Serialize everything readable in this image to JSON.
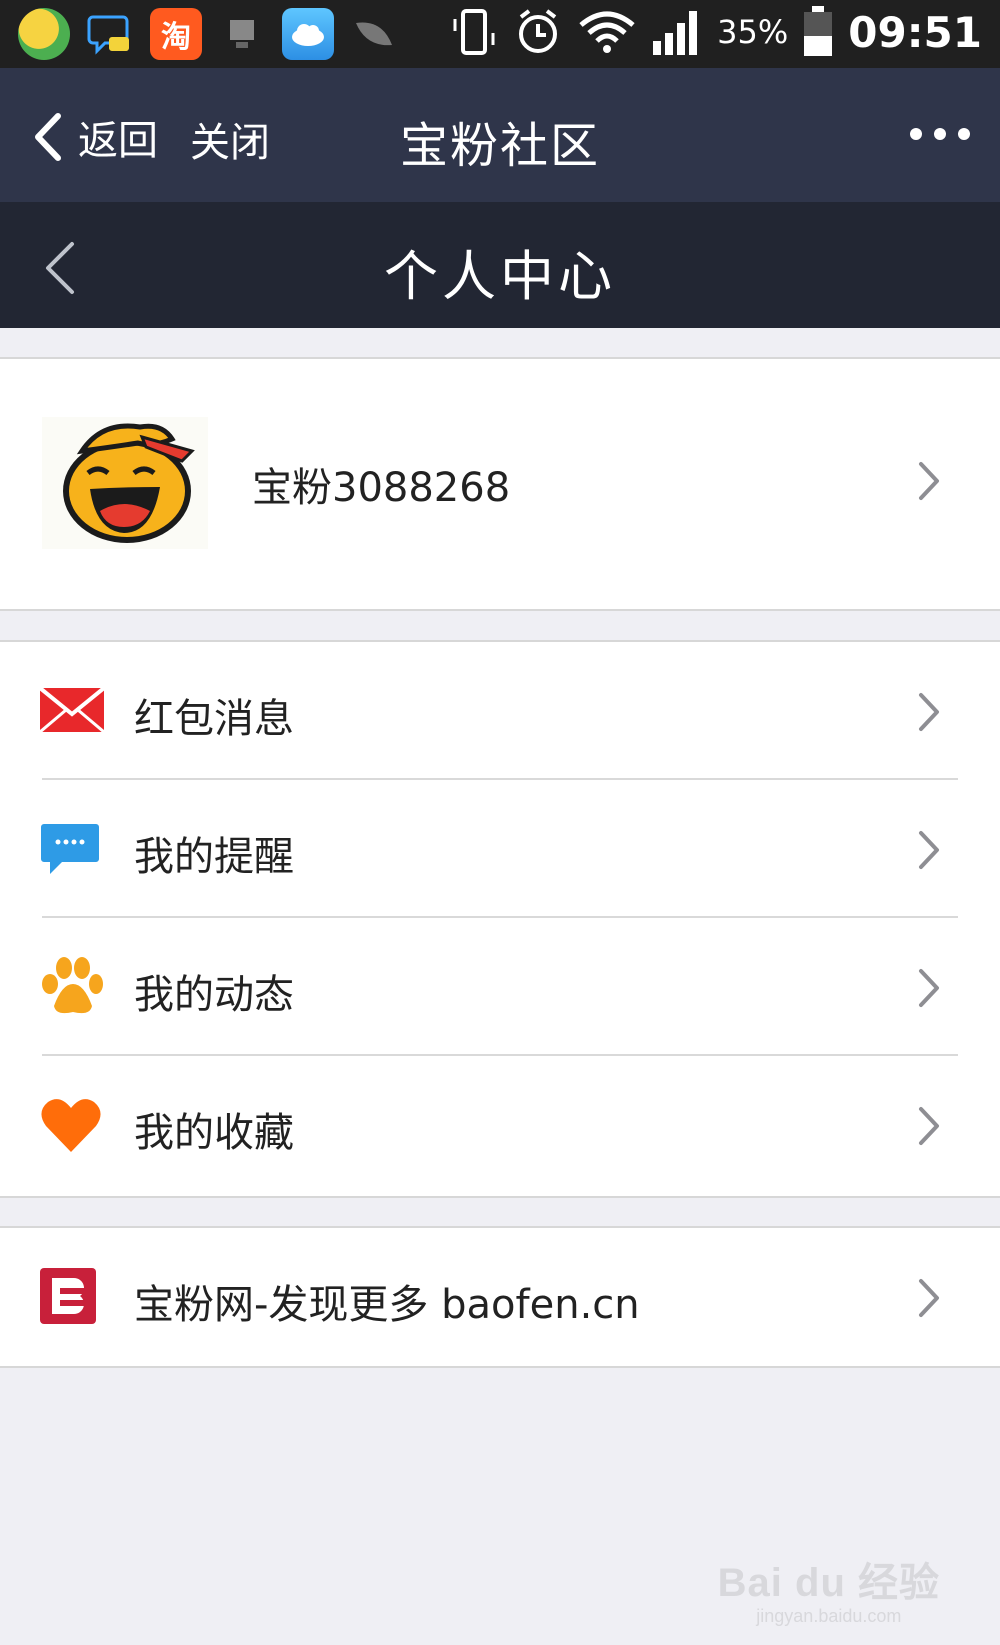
{
  "status_bar": {
    "notification_icons": [
      "app-360-icon",
      "chat-bubble-icon",
      "taobao-icon",
      "device-icon",
      "cloud-icon",
      "leaf-icon"
    ],
    "taobao_glyph": "淘",
    "battery_percent": "35%",
    "time": "09:51"
  },
  "top_nav": {
    "back_label": "返回",
    "close_label": "关闭",
    "title": "宝粉社区"
  },
  "sub_nav": {
    "title": "个人中心"
  },
  "profile": {
    "username": "宝粉3088268"
  },
  "menu": {
    "items": [
      {
        "label": "红包消息",
        "icon": "envelope-icon"
      },
      {
        "label": "我的提醒",
        "icon": "message-bubble-icon"
      },
      {
        "label": "我的动态",
        "icon": "paw-icon"
      },
      {
        "label": "我的收藏",
        "icon": "heart-icon"
      }
    ]
  },
  "site_link": {
    "label": "宝粉网-发现更多 baofen.cn",
    "icon": "baofen-logo-icon"
  },
  "watermark": {
    "main": "Bai du 经验",
    "sub": "jingyan.baidu.com"
  },
  "colors": {
    "nav_bg": "#2f354a",
    "subnav_bg": "#222633",
    "page_bg": "#efeff4",
    "envelope_red": "#e8282b",
    "bubble_blue": "#2e9be6",
    "paw_orange": "#f6a51d",
    "heart_orange": "#ff6d0a",
    "logo_red": "#c8203a"
  }
}
